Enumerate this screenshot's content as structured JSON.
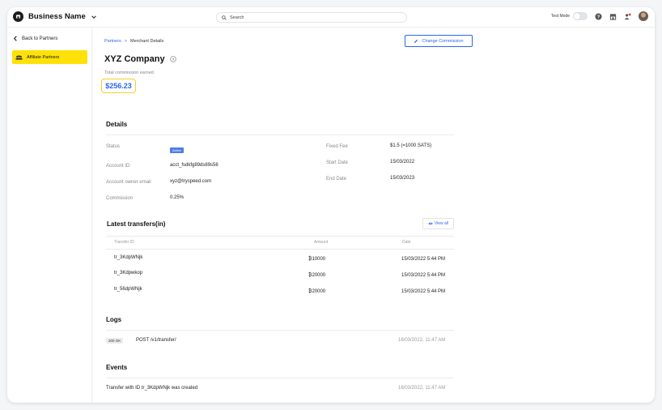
{
  "topbar": {
    "brand": "Business Name",
    "search_placeholder": "Search",
    "test_mode_label": "Test Mode"
  },
  "sidebar": {
    "back_label": "Back to Partners",
    "active_item": "Affiliate Partners"
  },
  "breadcrumb": {
    "root": "Partners",
    "current": "Merchant Details"
  },
  "change_commission_label": "Change Commission",
  "company_name": "XYZ Company",
  "total_commission_label": "Total commission earned",
  "total_commission_value": "$256.23",
  "details": {
    "title": "Details",
    "left": [
      {
        "label": "Status",
        "value": "Active"
      },
      {
        "label": "Account ID",
        "value": "acct_fsdkfg89ds89s56"
      },
      {
        "label": "Account owner email",
        "value": "xyz@tryspeed.com"
      },
      {
        "label": "Commission",
        "value": "0.25%"
      }
    ],
    "right": [
      {
        "label": "Fixed Fee",
        "value": "$1.5 (=1000 SATS)"
      },
      {
        "label": "Start Date",
        "value": "15/03/2022"
      },
      {
        "label": "End Date",
        "value": "15/03/2023"
      }
    ]
  },
  "transfers": {
    "title": "Latest transfers(in)",
    "view_all_label": "View all",
    "headers": [
      "Transfer ID",
      "Amount",
      "Date"
    ],
    "rows": [
      {
        "id": "tr_3KdpWNjk",
        "amount": "₿10000",
        "date": "15/03/2022 5:44 PM"
      },
      {
        "id": "tr_3Kdpwkop",
        "amount": "₿20000",
        "date": "15/03/2022 5:44 PM"
      },
      {
        "id": "tr_56dpWNjk",
        "amount": "₿20000",
        "date": "15/03/2022 5:44 PM"
      }
    ]
  },
  "logs": {
    "title": "Logs",
    "items": [
      {
        "status": "200 OK",
        "request": "POST /v1/transfer/",
        "time": "16/03/2022, 11:47 AM"
      }
    ]
  },
  "events": {
    "title": "Events",
    "items": [
      {
        "text": "Transfer with ID tr_3KdpWNjk was created",
        "time": "16/03/2022, 11:47 AM"
      }
    ]
  },
  "colors": {
    "accent": "#2a67f0",
    "highlight": "#ffe10a",
    "amount_border": "#f6cf2a"
  }
}
